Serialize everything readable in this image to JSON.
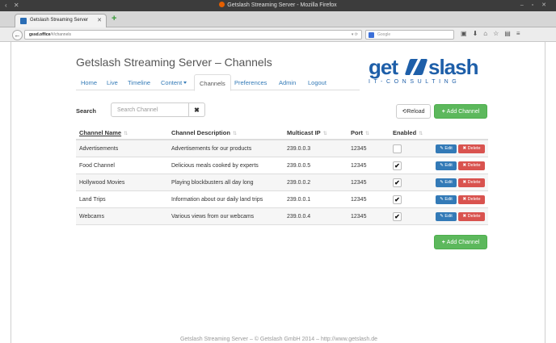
{
  "browser": {
    "window_title": "Getslash Streaming Server - Mozilla Firefox",
    "tab_title": "Getslash Streaming Server",
    "url_host": "gssd.office",
    "url_path": "/#/channels",
    "search_placeholder": "Google"
  },
  "page": {
    "title": "Getslash Streaming Server – Channels",
    "nav": [
      {
        "label": "Home"
      },
      {
        "label": "Live"
      },
      {
        "label": "Timeline"
      },
      {
        "label": "Content"
      },
      {
        "label": "Channels"
      },
      {
        "label": "Preferences"
      },
      {
        "label": "Admin"
      },
      {
        "label": "Logout"
      }
    ],
    "active_nav": "Channels",
    "logo": {
      "get": "get",
      "slash": "slash",
      "tagline": "IT-CONSULTING"
    }
  },
  "search": {
    "label": "Search",
    "placeholder": "Search Channel"
  },
  "buttons": {
    "reload": "Reload",
    "add_channel": "Add Channel",
    "edit": "Edit",
    "delete": "Delete"
  },
  "table": {
    "headers": {
      "name": "Channel Name",
      "description": "Channel Description",
      "ip": "Multicast IP",
      "port": "Port",
      "enabled": "Enabled"
    },
    "rows": [
      {
        "name": "Advertisements",
        "description": "Advertisements for our products",
        "ip": "239.0.0.3",
        "port": "12345",
        "enabled": false
      },
      {
        "name": "Food Channel",
        "description": "Delicious meals cooked by experts",
        "ip": "239.0.0.5",
        "port": "12345",
        "enabled": true
      },
      {
        "name": "Hollywood Movies",
        "description": "Playing blockbusters all day long",
        "ip": "239.0.0.2",
        "port": "12345",
        "enabled": true
      },
      {
        "name": "Land Trips",
        "description": "Information about our daily land trips",
        "ip": "239.0.0.1",
        "port": "12345",
        "enabled": true
      },
      {
        "name": "Webcams",
        "description": "Various views from our webcams",
        "ip": "239.0.0.4",
        "port": "12345",
        "enabled": true
      }
    ]
  },
  "footer": "Getslash Streaming Server – © Getslash GmbH 2014 – http://www.getslash.de",
  "colors": {
    "link": "#337ab7",
    "success": "#5cb85c",
    "danger": "#d9534f",
    "logo": "#1e5fa9"
  }
}
